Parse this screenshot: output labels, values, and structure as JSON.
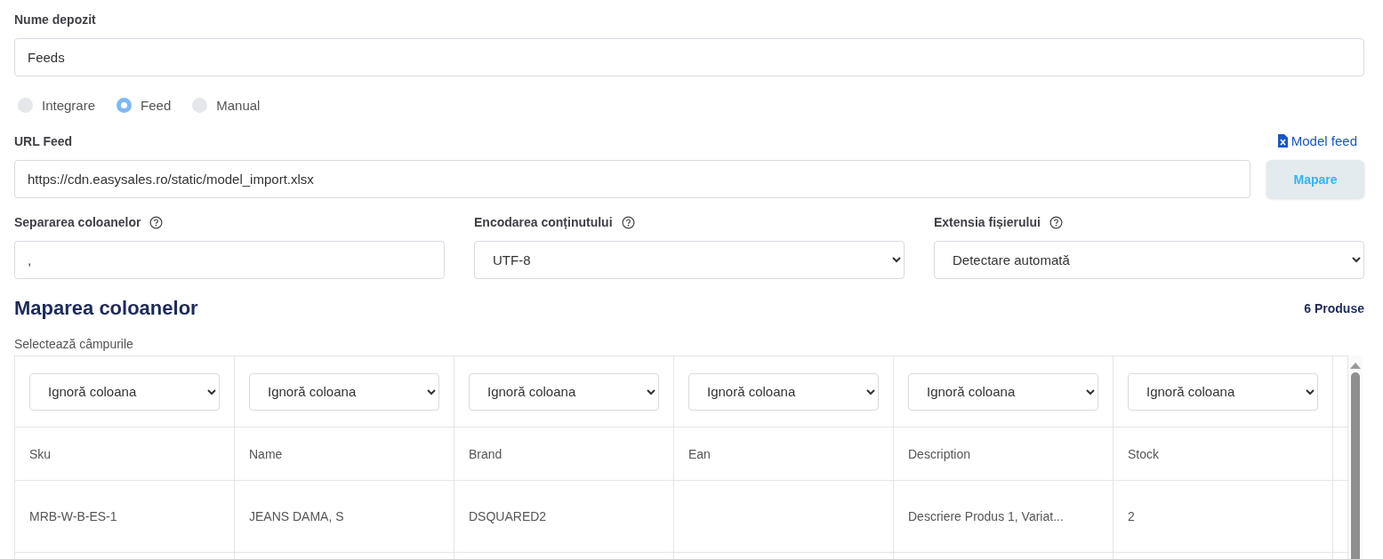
{
  "warehouse_name": {
    "label": "Nume depozit",
    "value": "Feeds"
  },
  "source_options": [
    {
      "label": "Integrare",
      "selected": false
    },
    {
      "label": "Feed",
      "selected": true
    },
    {
      "label": "Manual",
      "selected": false
    }
  ],
  "feed_url": {
    "label": "URL Feed",
    "value": "https://cdn.easysales.ro/static/model_import.xlsx",
    "model_link": "Model feed",
    "map_button": "Mapare"
  },
  "settings": [
    {
      "label": "Separarea coloanelor",
      "kind": "input",
      "value": ","
    },
    {
      "label": "Encodarea conținutului",
      "kind": "select",
      "value": "UTF-8"
    },
    {
      "label": "Extensia fișierului",
      "kind": "select",
      "value": "Detectare automată"
    }
  ],
  "mapping": {
    "title": "Maparea coloanelor",
    "count": "6 Produse",
    "hint": "Selectează câmpurile",
    "column_selects": [
      "Ignoră coloana",
      "Ignoră coloana",
      "Ignoră coloana",
      "Ignoră coloana",
      "Ignoră coloana",
      "Ignoră coloana"
    ],
    "headers": [
      "Sku",
      "Name",
      "Brand",
      "Ean",
      "Description",
      "Stock"
    ],
    "rows": [
      [
        "MRB-W-B-ES-1",
        "JEANS DAMA, S",
        "DSQUARED2",
        "",
        "Descriere Produs 1, Variat...",
        "2"
      ]
    ]
  }
}
